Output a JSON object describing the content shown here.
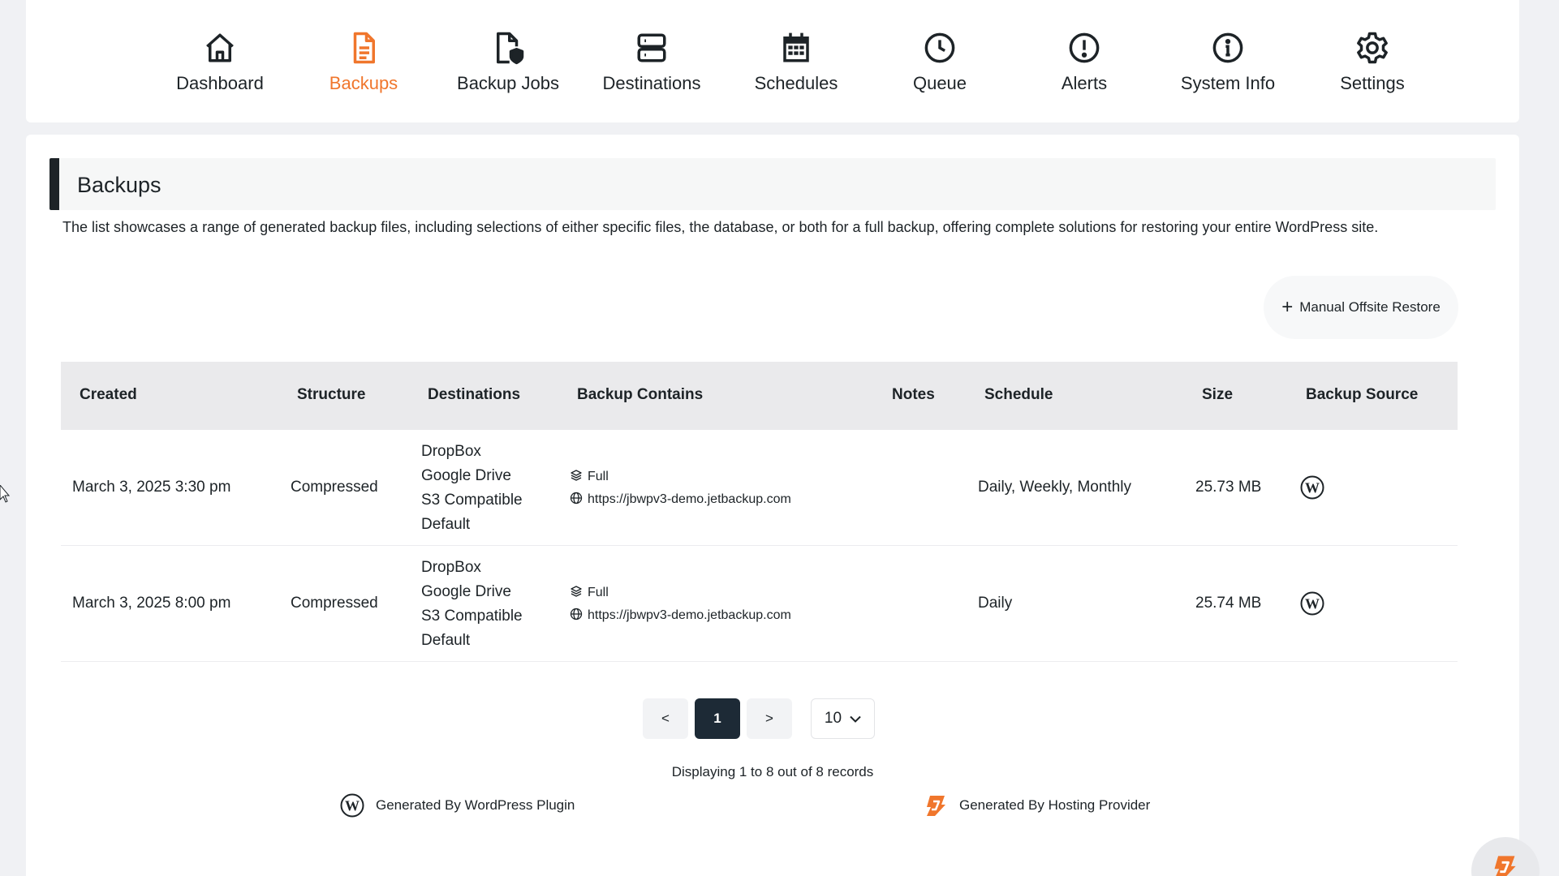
{
  "nav": {
    "items": [
      {
        "label": "Dashboard",
        "icon": "home-icon",
        "active": false
      },
      {
        "label": "Backups",
        "icon": "document-icon",
        "active": true
      },
      {
        "label": "Backup Jobs",
        "icon": "file-shield-icon",
        "active": false
      },
      {
        "label": "Destinations",
        "icon": "server-icon",
        "active": false
      },
      {
        "label": "Schedules",
        "icon": "calendar-icon",
        "active": false
      },
      {
        "label": "Queue",
        "icon": "clock-icon",
        "active": false
      },
      {
        "label": "Alerts",
        "icon": "alert-circle-icon",
        "active": false
      },
      {
        "label": "System Info",
        "icon": "info-circle-icon",
        "active": false
      },
      {
        "label": "Settings",
        "icon": "gear-icon",
        "active": false
      }
    ]
  },
  "page": {
    "title": "Backups",
    "description": "The list showcases a range of generated backup files, including selections of either specific files, the database, or both for a full backup, offering complete solutions for restoring your entire WordPress site.",
    "restore_button": "Manual Offsite Restore"
  },
  "table": {
    "headers": [
      "Created",
      "Structure",
      "Destinations",
      "Backup Contains",
      "Notes",
      "Schedule",
      "Size",
      "Backup Source"
    ],
    "rows": [
      {
        "created": "March 3, 2025 3:30 pm",
        "structure": "Compressed",
        "destinations": [
          "DropBox",
          "Google Drive",
          "S3 Compatible",
          "Default"
        ],
        "contains_type": "Full",
        "contains_url": "https://jbwpv3-demo.jetbackup.com",
        "notes": "",
        "schedule": "Daily, Weekly, Monthly",
        "size": "25.73 MB",
        "source_icon": "wordpress-icon"
      },
      {
        "created": "March 3, 2025 8:00 pm",
        "structure": "Compressed",
        "destinations": [
          "DropBox",
          "Google Drive",
          "S3 Compatible",
          "Default"
        ],
        "contains_type": "Full",
        "contains_url": "https://jbwpv3-demo.jetbackup.com",
        "notes": "",
        "schedule": "Daily",
        "size": "25.74 MB",
        "source_icon": "wordpress-icon"
      }
    ]
  },
  "pagination": {
    "prev": "<",
    "current": "1",
    "next": ">",
    "per_page": "10",
    "records_text": "Displaying 1 to 8 out of 8 records"
  },
  "legend": {
    "plugin": "Generated By WordPress Plugin",
    "hosting": "Generated By Hosting Provider"
  },
  "colors": {
    "accent": "#f0762c",
    "dark": "#1d2327",
    "pager_active": "#1d2a36"
  }
}
